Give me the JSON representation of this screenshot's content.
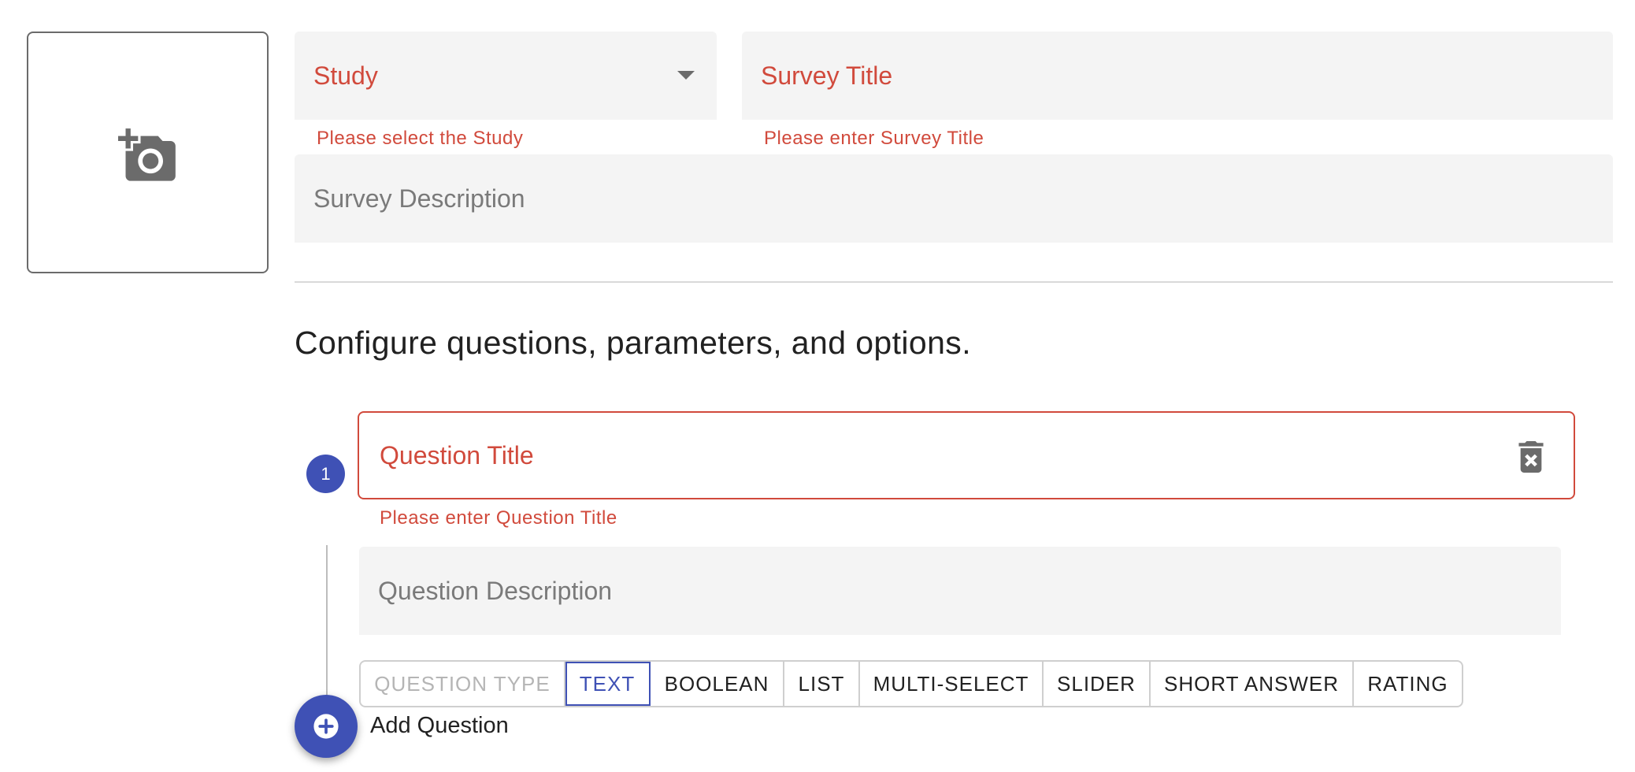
{
  "photo_picker": {
    "icon": "add-a-photo-icon"
  },
  "study_select": {
    "label": "Study",
    "helper": "Please select the Study",
    "icon": "dropdown-arrow-icon"
  },
  "survey_title": {
    "label": "Survey Title",
    "helper": "Please enter Survey Title"
  },
  "survey_description": {
    "placeholder": "Survey Description"
  },
  "section_heading": "Configure questions, parameters, and options.",
  "questions": [
    {
      "number": "1",
      "title_label": "Question Title",
      "title_helper": "Please enter Question Title",
      "description_placeholder": "Question Description",
      "delete_icon": "delete-forever-icon",
      "type_label": "QUESTION TYPE",
      "types": [
        "TEXT",
        "BOOLEAN",
        "LIST",
        "MULTI-SELECT",
        "SLIDER",
        "SHORT ANSWER",
        "RATING"
      ],
      "selected_type": "TEXT"
    }
  ],
  "add_question": {
    "label": "Add Question",
    "icon": "add-circle-icon"
  },
  "colors": {
    "error": "#d14a3c",
    "primary": "#3f51b5",
    "field_bg": "#f4f4f4",
    "muted": "#7a7a7a"
  }
}
